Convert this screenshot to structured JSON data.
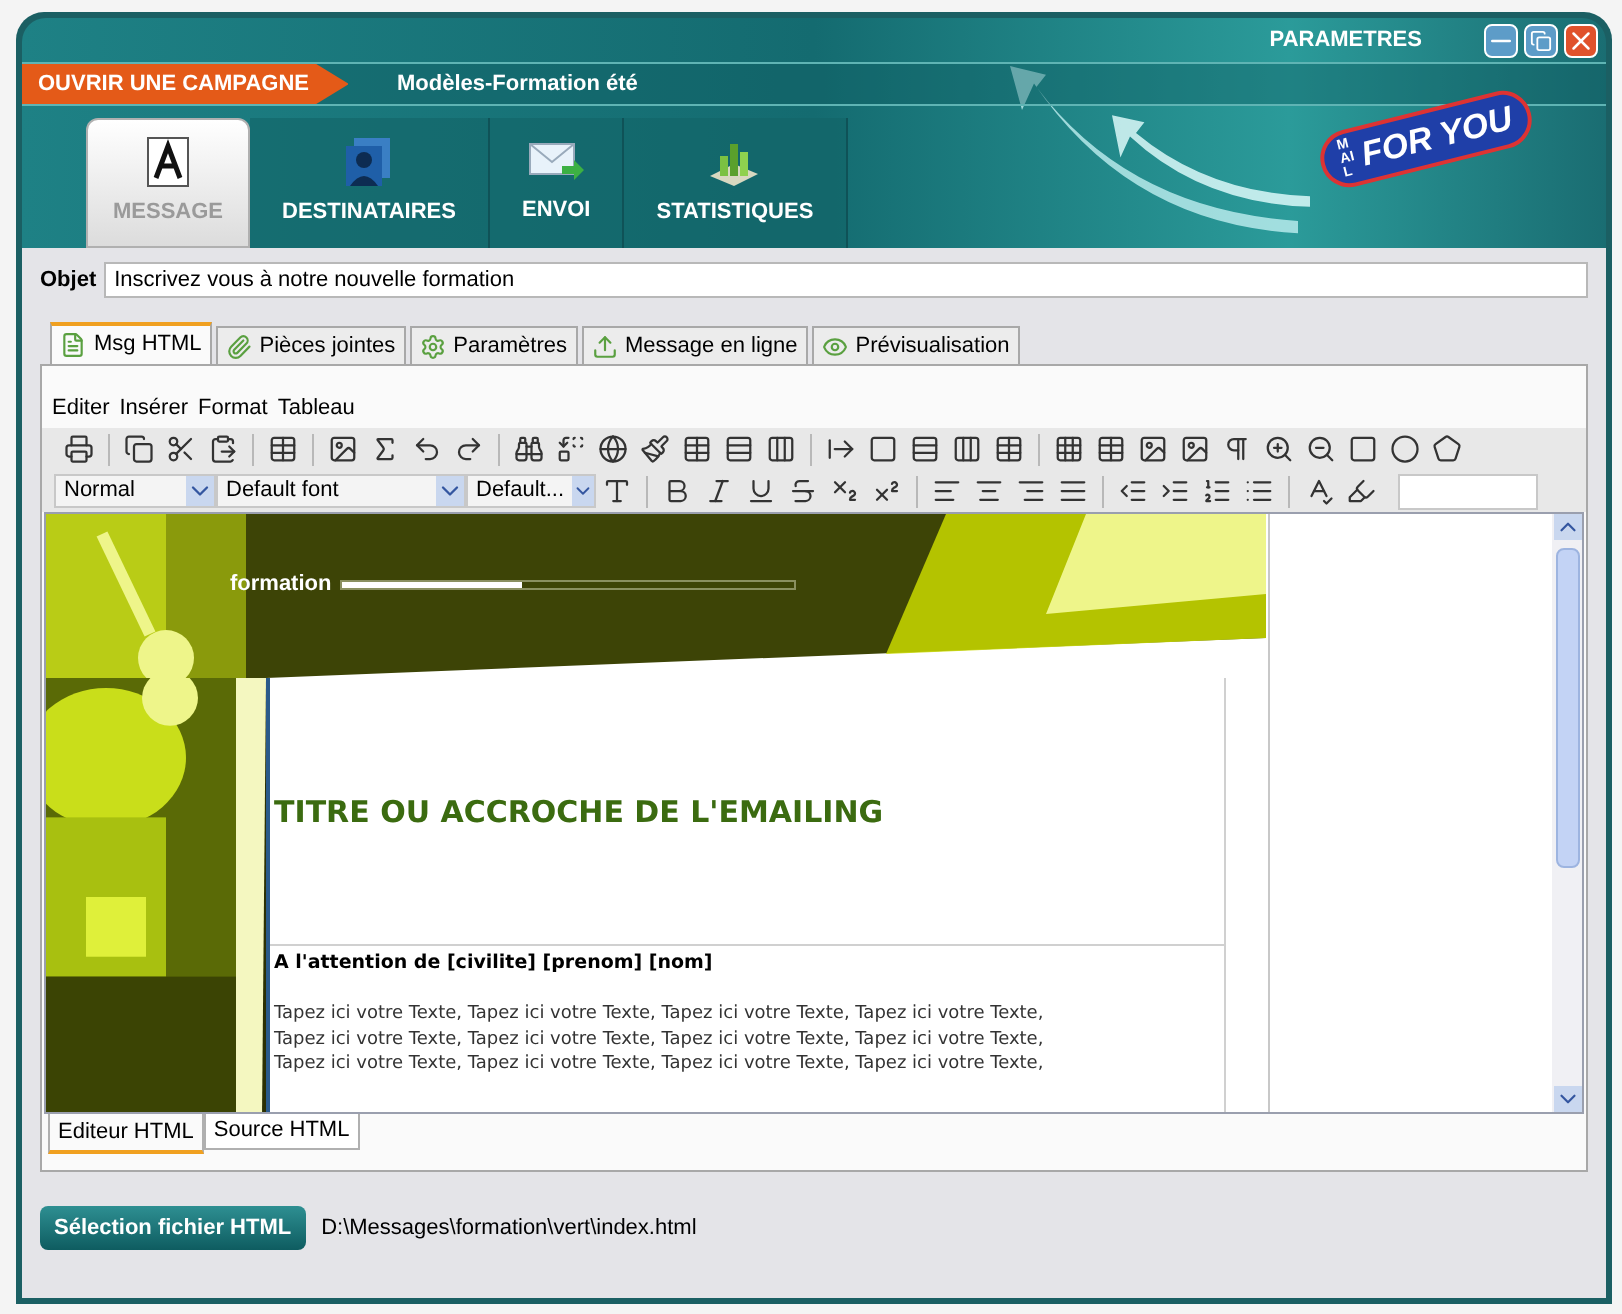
{
  "window": {
    "settings_label": "PARAMETRES"
  },
  "campaign": {
    "open_button": "OUVRIR UNE CAMPAGNE",
    "name": "Modèles-Formation été"
  },
  "nav_tabs": [
    {
      "label": "MESSAGE",
      "kind": "message",
      "selected": true
    },
    {
      "label": "DESTINATAIRES",
      "kind": "recipients",
      "selected": false
    },
    {
      "label": "ENVOI",
      "kind": "send",
      "selected": false
    },
    {
      "label": "STATISTIQUES",
      "kind": "stats",
      "selected": false
    }
  ],
  "logo": {
    "small": "MAIL",
    "large": "FOR YOU"
  },
  "subject": {
    "label": "Objet",
    "value": "Inscrivez vous à notre nouvelle formation"
  },
  "editor_tabs": [
    {
      "label": "Msg HTML",
      "selected": true
    },
    {
      "label": "Pièces jointes",
      "selected": false
    },
    {
      "label": "Paramètres",
      "selected": false
    },
    {
      "label": "Message en ligne",
      "selected": false
    },
    {
      "label": "Prévisualisation",
      "selected": false
    }
  ],
  "menu": [
    "Editer",
    "Insérer",
    "Format",
    "Tableau"
  ],
  "format_bar": {
    "style": "Normal",
    "font": "Default font",
    "size": "Default..."
  },
  "document": {
    "banner_word": "formation",
    "heading": "TITRE OU ACCROCHE DE L'EMAILING",
    "salutation": "A l'attention de [civilite] [prenom] [nom]",
    "body_lines": [
      "Tapez ici votre Texte, Tapez ici votre Texte, Tapez ici votre Texte, Tapez ici votre Texte,",
      "Tapez ici votre Texte, Tapez ici votre Texte, Tapez ici votre Texte, Tapez ici votre Texte,",
      "Tapez ici votre Texte, Tapez ici votre Texte, Tapez ici votre Texte, Tapez ici votre Texte,"
    ]
  },
  "view_tabs": [
    {
      "label": "Editeur HTML",
      "selected": true
    },
    {
      "label": "Source HTML",
      "selected": false
    }
  ],
  "file": {
    "button": "Sélection fichier HTML",
    "path": "D:\\Messages\\formation\\vert\\index.html"
  }
}
